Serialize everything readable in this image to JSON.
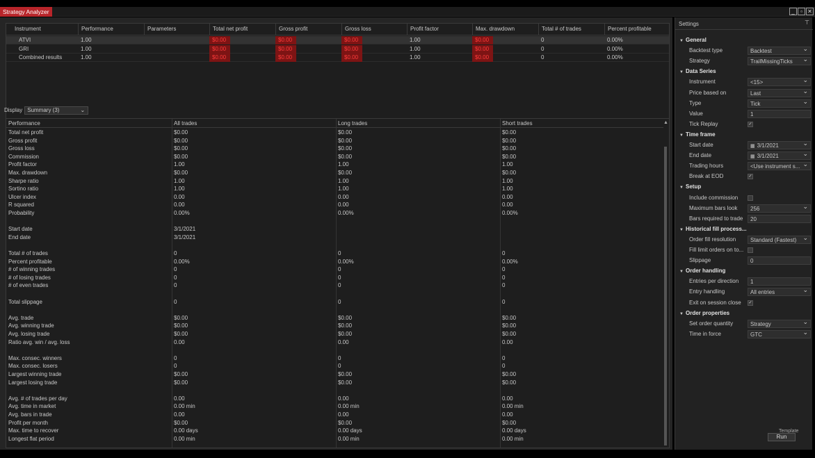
{
  "window": {
    "title": "Strategy Analyzer"
  },
  "instruments_table": {
    "headers": [
      "Instrument",
      "Performance",
      "Parameters",
      "Total net profit",
      "Gross profit",
      "Gross loss",
      "Profit factor",
      "Max. drawdown",
      "Total # of trades",
      "Percent profitable"
    ],
    "rows": [
      [
        "ATVI",
        "1.00",
        "",
        "$0.00",
        "$0.00",
        "$0.00",
        "1.00",
        "$0.00",
        "0",
        "0.00%"
      ],
      [
        "GRI",
        "1.00",
        "",
        "$0.00",
        "$0.00",
        "$0.00",
        "1.00",
        "$0.00",
        "0",
        "0.00%"
      ],
      [
        "Combined results",
        "1.00",
        "",
        "$0.00",
        "$0.00",
        "$0.00",
        "1.00",
        "$0.00",
        "0",
        "0.00%"
      ]
    ]
  },
  "display": {
    "label": "Display",
    "value": "Summary (3)"
  },
  "performance": {
    "headers": [
      "Performance",
      "All trades",
      "Long trades",
      "Short trades"
    ],
    "rows": [
      [
        "Total net profit",
        "$0.00",
        "$0.00",
        "$0.00"
      ],
      [
        "Gross profit",
        "$0.00",
        "$0.00",
        "$0.00"
      ],
      [
        "Gross loss",
        "$0.00",
        "$0.00",
        "$0.00"
      ],
      [
        "Commission",
        "$0.00",
        "$0.00",
        "$0.00"
      ],
      [
        "Profit factor",
        "1.00",
        "1.00",
        "1.00"
      ],
      [
        "Max. drawdown",
        "$0.00",
        "$0.00",
        "$0.00"
      ],
      [
        "Sharpe ratio",
        "1.00",
        "1.00",
        "1.00"
      ],
      [
        "Sortino ratio",
        "1.00",
        "1.00",
        "1.00"
      ],
      [
        "Ulcer index",
        "0.00",
        "0.00",
        "0.00"
      ],
      [
        "R squared",
        "0.00",
        "0.00",
        "0.00"
      ],
      [
        "Probability",
        "0.00%",
        "0.00%",
        "0.00%"
      ],
      [
        "",
        "",
        "",
        ""
      ],
      [
        "Start date",
        "3/1/2021",
        "",
        ""
      ],
      [
        "End date",
        "3/1/2021",
        "",
        ""
      ],
      [
        "",
        "",
        "",
        ""
      ],
      [
        "Total # of trades",
        "0",
        "0",
        "0"
      ],
      [
        "Percent profitable",
        "0.00%",
        "0.00%",
        "0.00%"
      ],
      [
        "# of winning trades",
        "0",
        "0",
        "0"
      ],
      [
        "# of losing trades",
        "0",
        "0",
        "0"
      ],
      [
        "# of even trades",
        "0",
        "0",
        "0"
      ],
      [
        "",
        "",
        "",
        ""
      ],
      [
        "Total slippage",
        "0",
        "0",
        "0"
      ],
      [
        "",
        "",
        "",
        ""
      ],
      [
        "Avg. trade",
        "$0.00",
        "$0.00",
        "$0.00"
      ],
      [
        "Avg. winning trade",
        "$0.00",
        "$0.00",
        "$0.00"
      ],
      [
        "Avg. losing trade",
        "$0.00",
        "$0.00",
        "$0.00"
      ],
      [
        "Ratio avg. win / avg. loss",
        "0.00",
        "0.00",
        "0.00"
      ],
      [
        "",
        "",
        "",
        ""
      ],
      [
        "Max. consec. winners",
        "0",
        "0",
        "0"
      ],
      [
        "Max. consec. losers",
        "0",
        "0",
        "0"
      ],
      [
        "Largest winning trade",
        "$0.00",
        "$0.00",
        "$0.00"
      ],
      [
        "Largest losing trade",
        "$0.00",
        "$0.00",
        "$0.00"
      ],
      [
        "",
        "",
        "",
        ""
      ],
      [
        "Avg. # of trades per day",
        "0.00",
        "0.00",
        "0.00"
      ],
      [
        "Avg. time in market",
        "0.00 min",
        "0.00 min",
        "0.00 min"
      ],
      [
        "Avg. bars in trade",
        "0.00",
        "0.00",
        "0.00"
      ],
      [
        "Profit per month",
        "$0.00",
        "$0.00",
        "$0.00"
      ],
      [
        "Max. time to recover",
        "0.00 days",
        "0.00 days",
        "0.00 days"
      ],
      [
        "Longest flat period",
        "0.00 min",
        "0.00 min",
        "0.00 min"
      ]
    ]
  },
  "settings": {
    "title": "Settings",
    "sections": [
      {
        "name": "General",
        "props": [
          {
            "label": "Backtest type",
            "value": "Backtest",
            "kind": "dropdown"
          },
          {
            "label": "Strategy",
            "value": "TrailMissingTicks",
            "kind": "dropdown"
          }
        ]
      },
      {
        "name": "Data Series",
        "props": [
          {
            "label": "Instrument",
            "value": "<15>",
            "kind": "dropdown"
          },
          {
            "label": "Price based on",
            "value": "Last",
            "kind": "dropdown"
          },
          {
            "label": "Type",
            "value": "Tick",
            "kind": "dropdown"
          },
          {
            "label": "Value",
            "value": "1",
            "kind": "text"
          },
          {
            "label": "Tick Replay",
            "value": "✓",
            "kind": "check"
          }
        ]
      },
      {
        "name": "Time frame",
        "props": [
          {
            "label": "Start date",
            "value": "3/1/2021",
            "kind": "date"
          },
          {
            "label": "End date",
            "value": "3/1/2021",
            "kind": "date"
          },
          {
            "label": "Trading hours",
            "value": "<Use instrument s...",
            "kind": "dropdown"
          },
          {
            "label": "Break at EOD",
            "value": "✓",
            "kind": "check"
          }
        ]
      },
      {
        "name": "Setup",
        "props": [
          {
            "label": "Include commission",
            "value": "",
            "kind": "check"
          },
          {
            "label": "Maximum bars look",
            "value": "256",
            "kind": "dropdown"
          },
          {
            "label": "Bars required to trade",
            "value": "20",
            "kind": "text"
          }
        ]
      },
      {
        "name": "Historical fill process...",
        "props": [
          {
            "label": "Order fill resolution",
            "value": "Standard (Fastest)",
            "kind": "dropdown"
          },
          {
            "label": "Fill limit orders on to...",
            "value": "",
            "kind": "check"
          },
          {
            "label": "Slippage",
            "value": "0",
            "kind": "text"
          }
        ]
      },
      {
        "name": "Order handling",
        "props": [
          {
            "label": "Entries per direction",
            "value": "1",
            "kind": "text"
          },
          {
            "label": "Entry handling",
            "value": "All entries",
            "kind": "dropdown"
          },
          {
            "label": "Exit on session close",
            "value": "✓",
            "kind": "check"
          }
        ]
      },
      {
        "name": "Order properties",
        "props": [
          {
            "label": "Set order quantity",
            "value": "Strategy",
            "kind": "dropdown"
          },
          {
            "label": "Time in force",
            "value": "GTC",
            "kind": "dropdown"
          }
        ]
      }
    ]
  },
  "footer": {
    "run_label": "Run",
    "template_label": "Template"
  },
  "colors": {
    "accent": "#b8252a",
    "negative_bg": "#7d1414",
    "negative_text": "#ff3b3b"
  },
  "icons": {
    "collapse": "triangle-down-icon",
    "dropdown": "chevron-down-icon",
    "calendar": "calendar-icon",
    "pin": "pin-icon"
  }
}
